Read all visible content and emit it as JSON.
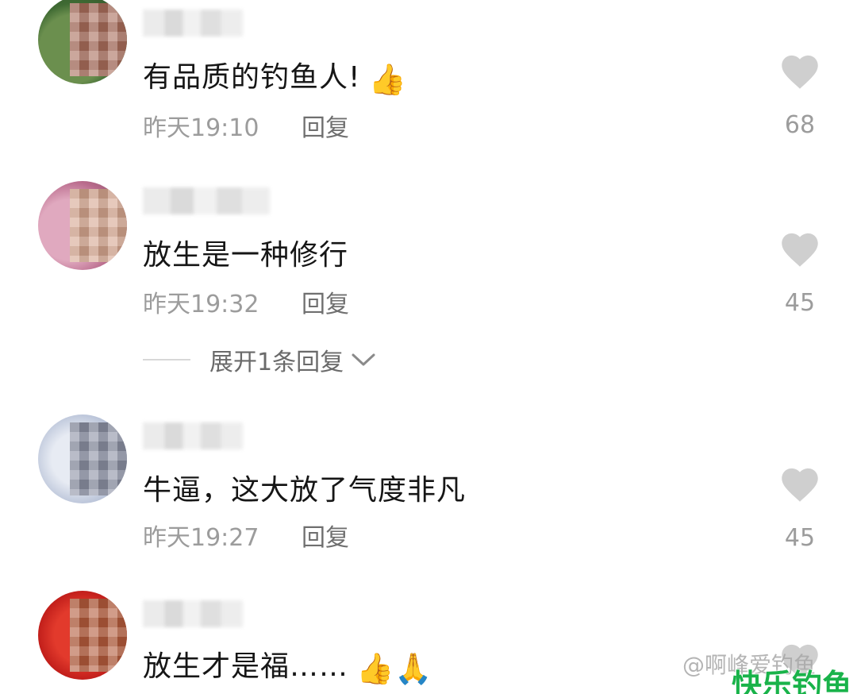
{
  "comments": [
    {
      "text": "有品质的钓鱼人!",
      "emoji": "👍",
      "time": "昨天19:10",
      "reply": "回复",
      "likes": "68",
      "avatar_color": "#4d7a3a"
    },
    {
      "text": "放生是一种修行",
      "emoji": "",
      "time": "昨天19:32",
      "reply": "回复",
      "likes": "45",
      "avatar_color": "#c98aa4"
    },
    {
      "text": "牛逼，这大放了气度非凡",
      "emoji": "",
      "time": "昨天19:27",
      "reply": "回复",
      "likes": "45",
      "avatar_color": "#c9d0df"
    },
    {
      "text": "放生才是福……",
      "emoji": "👍🙏",
      "time": "",
      "reply": "",
      "likes": "",
      "avatar_color": "#c9221e"
    }
  ],
  "expand_replies": {
    "label": "展开1条回复"
  },
  "watermark": {
    "text": "@啊峰爱钓鱼",
    "brand": "快乐钓鱼"
  },
  "colors": {
    "heart": "#cfcfcf",
    "brand": "#19b34a",
    "meta": "#9c9c9c"
  }
}
